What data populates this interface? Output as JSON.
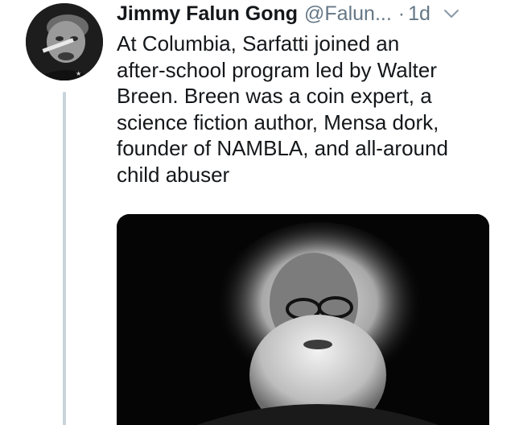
{
  "tweet": {
    "display_name": "Jimmy Falun Gong",
    "handle": "@Falun...",
    "separator": "·",
    "timestamp": "1d",
    "text_lines": [
      "At Columbia, Sarfatti joined an",
      "after-school program led by Walter",
      "Breen. Breen was a coin expert, a",
      "science fiction author, Mensa dork,",
      "founder of NAMBLA, and all-around",
      "child abuser"
    ]
  },
  "icons": {
    "menu": "chevron-down-icon"
  },
  "colors": {
    "text": "#14171a",
    "secondary": "#657786",
    "thread_line": "#c9d3db"
  }
}
